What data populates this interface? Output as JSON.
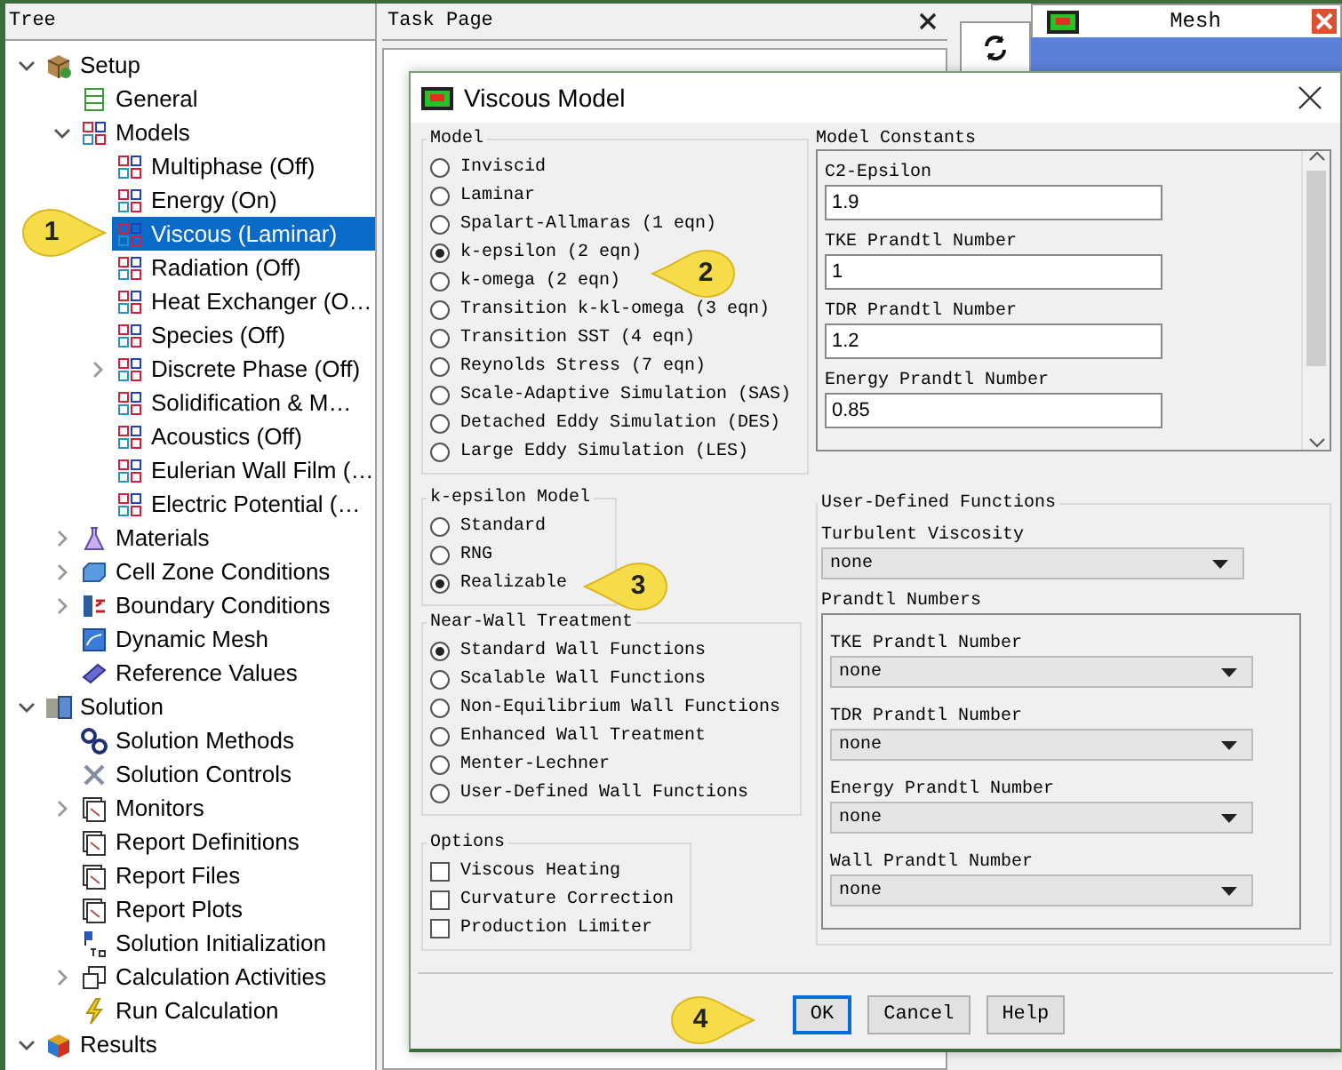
{
  "tree": {
    "title": "Tree",
    "items": [
      {
        "label": "Setup",
        "expanded": true,
        "selected": false,
        "children": [
          {
            "label": "General",
            "selected": false
          },
          {
            "label": "Models",
            "expanded": true,
            "selected": false,
            "children": [
              {
                "label": "Multiphase (Off)",
                "selected": false
              },
              {
                "label": "Energy (On)",
                "selected": false
              },
              {
                "label": "Viscous (Laminar)",
                "selected": true
              },
              {
                "label": "Radiation (Off)",
                "selected": false
              },
              {
                "label": "Heat Exchanger (O…",
                "selected": false
              },
              {
                "label": "Species (Off)",
                "selected": false
              },
              {
                "label": "Discrete Phase (Off)",
                "expanded": false,
                "selected": false
              },
              {
                "label": "Solidification & M…",
                "selected": false
              },
              {
                "label": "Acoustics (Off)",
                "selected": false
              },
              {
                "label": "Eulerian Wall Film (…",
                "selected": false
              },
              {
                "label": "Electric Potential (…",
                "selected": false
              }
            ]
          },
          {
            "label": "Materials",
            "expanded": false,
            "selected": false
          },
          {
            "label": "Cell Zone Conditions",
            "expanded": false,
            "selected": false
          },
          {
            "label": "Boundary Conditions",
            "expanded": false,
            "selected": false
          },
          {
            "label": "Dynamic Mesh",
            "selected": false
          },
          {
            "label": "Reference Values",
            "selected": false
          }
        ]
      },
      {
        "label": "Solution",
        "expanded": true,
        "selected": false,
        "children": [
          {
            "label": "Solution Methods",
            "selected": false
          },
          {
            "label": "Solution Controls",
            "selected": false
          },
          {
            "label": "Monitors",
            "expanded": false,
            "selected": false
          },
          {
            "label": "Report Definitions",
            "selected": false
          },
          {
            "label": "Report Files",
            "selected": false
          },
          {
            "label": "Report Plots",
            "selected": false
          },
          {
            "label": "Solution Initialization",
            "selected": false
          },
          {
            "label": "Calculation Activities",
            "expanded": false,
            "selected": false
          },
          {
            "label": "Run Calculation",
            "selected": false
          }
        ]
      },
      {
        "label": "Results",
        "expanded": true,
        "selected": false
      }
    ]
  },
  "task_page": {
    "title": "Task Page"
  },
  "graphics": {
    "tab_title": "Mesh"
  },
  "dialog": {
    "title": "Viscous Model",
    "model": {
      "title": "Model",
      "options": [
        {
          "label": "Inviscid",
          "selected": false
        },
        {
          "label": "Laminar",
          "selected": false
        },
        {
          "label": "Spalart-Allmaras (1 eqn)",
          "selected": false
        },
        {
          "label": "k-epsilon (2 eqn)",
          "selected": true
        },
        {
          "label": "k-omega (2 eqn)",
          "selected": false
        },
        {
          "label": "Transition k-kl-omega (3 eqn)",
          "selected": false
        },
        {
          "label": "Transition SST (4 eqn)",
          "selected": false
        },
        {
          "label": "Reynolds Stress (7 eqn)",
          "selected": false
        },
        {
          "label": "Scale-Adaptive Simulation (SAS)",
          "selected": false
        },
        {
          "label": "Detached Eddy Simulation (DES)",
          "selected": false
        },
        {
          "label": "Large Eddy Simulation (LES)",
          "selected": false
        }
      ]
    },
    "k_epsilon_model": {
      "title": "k-epsilon Model",
      "options": [
        {
          "label": "Standard",
          "selected": false
        },
        {
          "label": "RNG",
          "selected": false
        },
        {
          "label": "Realizable",
          "selected": true
        }
      ]
    },
    "near_wall_treatment": {
      "title": "Near-Wall Treatment",
      "options": [
        {
          "label": "Standard Wall Functions",
          "selected": true
        },
        {
          "label": "Scalable Wall Functions",
          "selected": false
        },
        {
          "label": "Non-Equilibrium Wall Functions",
          "selected": false
        },
        {
          "label": "Enhanced Wall Treatment",
          "selected": false
        },
        {
          "label": "Menter-Lechner",
          "selected": false
        },
        {
          "label": "User-Defined Wall Functions",
          "selected": false
        }
      ]
    },
    "options": {
      "title": "Options",
      "items": [
        {
          "label": "Viscous Heating",
          "checked": false
        },
        {
          "label": "Curvature Correction",
          "checked": false
        },
        {
          "label": "Production Limiter",
          "checked": false
        }
      ]
    },
    "model_constants": {
      "title": "Model Constants",
      "fields": [
        {
          "label": "C2-Epsilon",
          "value": "1.9"
        },
        {
          "label": "TKE Prandtl Number",
          "value": "1"
        },
        {
          "label": "TDR Prandtl Number",
          "value": "1.2"
        },
        {
          "label": "Energy Prandtl Number",
          "value": "0.85"
        }
      ]
    },
    "user_defined_functions": {
      "title": "User-Defined Functions",
      "turbulent_viscosity": {
        "label": "Turbulent Viscosity",
        "value": "none"
      },
      "prandtl_numbers": {
        "title": "Prandtl Numbers",
        "fields": [
          {
            "label": "TKE Prandtl Number",
            "value": "none"
          },
          {
            "label": "TDR Prandtl Number",
            "value": "none"
          },
          {
            "label": "Energy Prandtl Number",
            "value": "none"
          },
          {
            "label": "Wall Prandtl Number",
            "value": "none"
          }
        ]
      }
    },
    "buttons": [
      {
        "label": "OK",
        "focused": true
      },
      {
        "label": "Cancel",
        "focused": false
      },
      {
        "label": "Help",
        "focused": false
      }
    ]
  },
  "callouts": [
    {
      "label": "1"
    },
    {
      "label": "2"
    },
    {
      "label": "3"
    },
    {
      "label": "4"
    }
  ]
}
